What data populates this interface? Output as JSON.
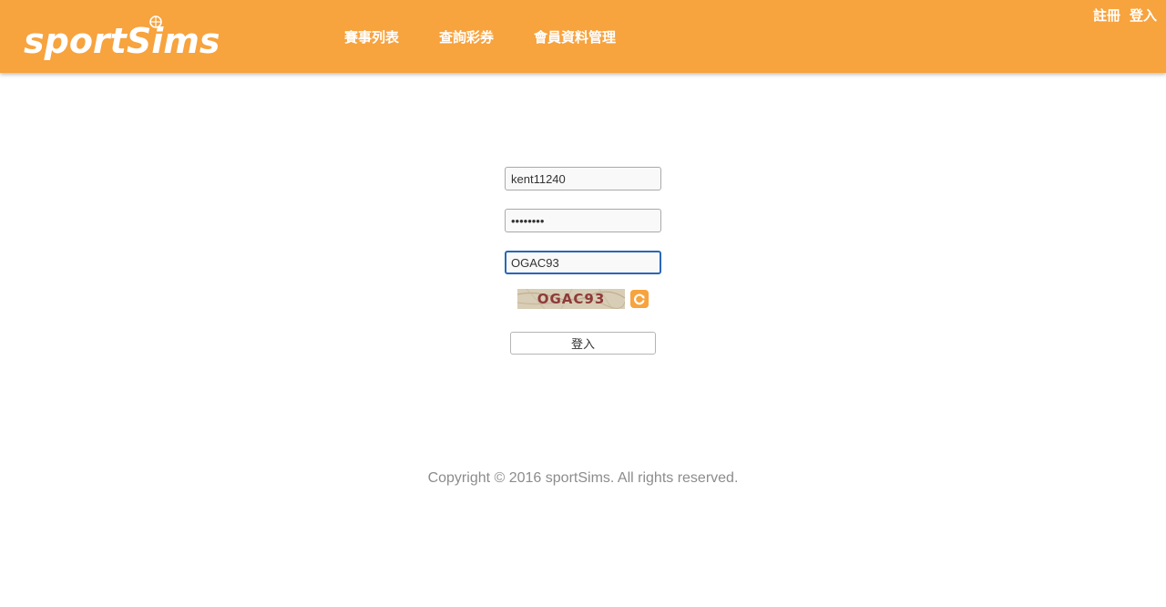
{
  "brand": {
    "logo_text": "sportSims",
    "color": "#f7a33e"
  },
  "nav": {
    "items": [
      {
        "label": "賽事列表"
      },
      {
        "label": "查詢彩券"
      },
      {
        "label": "會員資料管理"
      }
    ]
  },
  "top_links": {
    "register": "註冊",
    "login": "登入"
  },
  "login_form": {
    "username": "kent11240",
    "password": "••••••••",
    "captcha_input": "OGAC93",
    "captcha_image_text": "OGAC93",
    "submit_label": "登入",
    "refresh_icon": "refresh-icon"
  },
  "footer": {
    "copyright": "Copyright © 2016 sportSims. All rights reserved."
  }
}
